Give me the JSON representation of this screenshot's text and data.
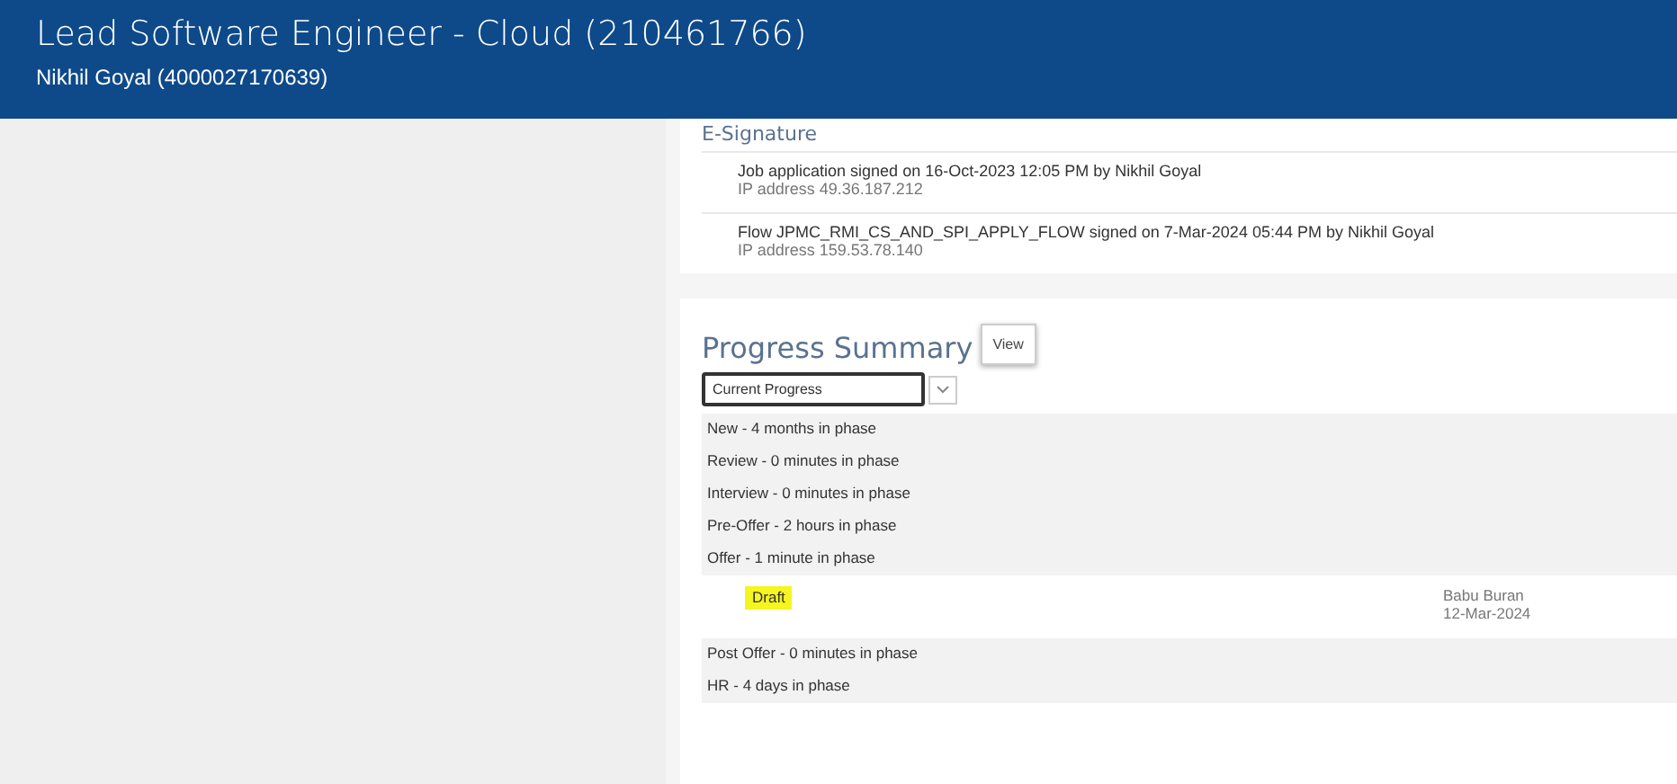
{
  "header": {
    "title": "Lead Software Engineer - Cloud (210461766)",
    "subtitle": "Nikhil Goyal (4000027170639)"
  },
  "esignature": {
    "title": "E-Signature",
    "entries": [
      {
        "text": "Job application signed on 16-Oct-2023 12:05 PM  by Nikhil Goyal",
        "ip": "IP address 49.36.187.212"
      },
      {
        "text": "Flow JPMC_RMI_CS_AND_SPI_APPLY_FLOW signed on 7-Mar-2024 05:44 PM  by Nikhil Goyal",
        "ip": "IP address 159.53.78.140"
      }
    ]
  },
  "progress": {
    "title": "Progress Summary",
    "tooltip": "View",
    "select": {
      "value": "Current Progress"
    },
    "rows": [
      {
        "kind": "phase",
        "text": "New - 4 months in phase"
      },
      {
        "kind": "phase",
        "text": "Review - 0 minutes in phase"
      },
      {
        "kind": "phase",
        "text": "Interview - 0 minutes in phase"
      },
      {
        "kind": "phase",
        "text": "Pre-Offer - 2 hours in phase"
      },
      {
        "kind": "phase",
        "text": "Offer - 1 minute in phase"
      },
      {
        "kind": "detail",
        "status": "Draft",
        "person": "Babu Buran",
        "date": "12-Mar-2024"
      },
      {
        "kind": "phase",
        "text": "Post Offer - 0 minutes in phase"
      },
      {
        "kind": "phase",
        "text": "HR - 4 days in phase"
      }
    ]
  }
}
